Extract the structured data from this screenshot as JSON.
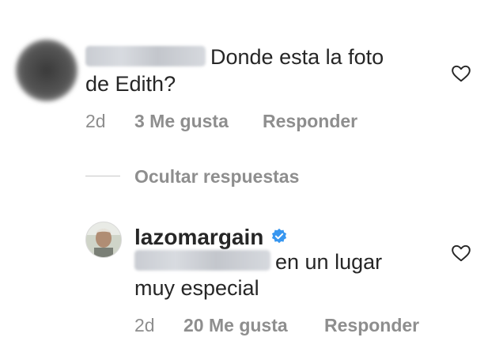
{
  "comments": [
    {
      "text_line1": "Donde esta la foto",
      "text_line2": "de Edith?",
      "time": "2d",
      "likes": "3 Me gusta",
      "reply": "Responder"
    }
  ],
  "hide_replies": "Ocultar respuestas",
  "reply": {
    "username": "lazomargain",
    "text_line1": "en un lugar",
    "text_line2": "muy especial",
    "time": "2d",
    "likes": "20 Me gusta",
    "reply": "Responder"
  },
  "icons": {
    "like": "heart-outline-icon",
    "verified": "verified-badge-icon"
  },
  "colors": {
    "text": "#262626",
    "secondary": "#8e8e8e",
    "verified": "#3897f0"
  }
}
